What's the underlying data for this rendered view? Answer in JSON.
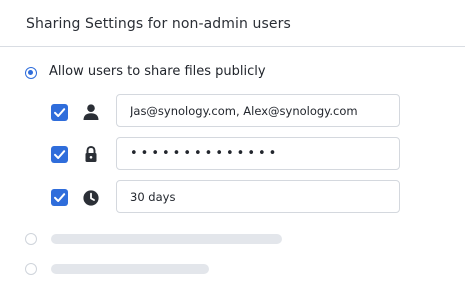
{
  "header": {
    "title": "Sharing Settings for non-admin users"
  },
  "share_option": {
    "label": "Allow users to share files publicly",
    "selected": true
  },
  "fields": {
    "users": {
      "value": "Jas@synology.com, Alex@synology.com",
      "checked": true,
      "icon": "person-icon"
    },
    "password": {
      "value": "••••••••••••••",
      "checked": true,
      "icon": "lock-icon"
    },
    "expiry": {
      "value": "30 days",
      "checked": true,
      "icon": "clock-icon"
    }
  },
  "colors": {
    "accent": "#2f6ddb",
    "border": "#d4d8de",
    "placeholder": "#e3e6eb",
    "icon": "#2b2f36"
  }
}
